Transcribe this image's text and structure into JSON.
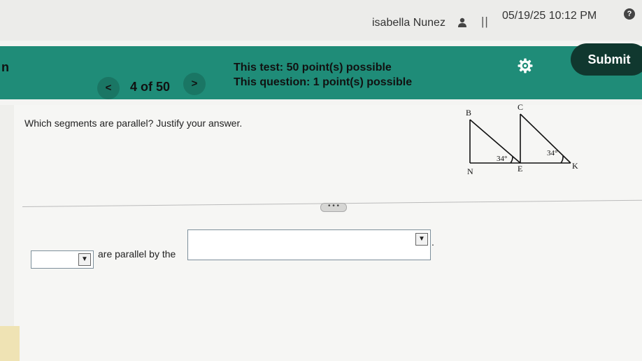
{
  "header": {
    "user_name": "isabella Nunez",
    "divider": "||",
    "datetime": "05/19/25 10:12 PM",
    "help_label": "?"
  },
  "toolbar": {
    "left_fragment": "n",
    "prev_label": "<",
    "position": "4 of 50",
    "next_label": ">",
    "test_points": "This test: 50 point(s) possible",
    "question_points": "This question: 1 point(s) possible",
    "submit_label": "Submit"
  },
  "question": {
    "text": "Which segments are parallel? Justify your answer.",
    "diagram": {
      "labels": {
        "B": "B",
        "C": "C",
        "N": "N",
        "E": "E",
        "K": "K"
      },
      "angle_left": "34°",
      "angle_right": "34°"
    },
    "more_label": "• • •"
  },
  "answer": {
    "segments_value": "",
    "middle_text": "are parallel by the",
    "reason_value": "",
    "period": ".",
    "arrow_glyph": "▼"
  },
  "colors": {
    "green_bar": "#1f8c78",
    "submit_bg": "#10382f",
    "page_bg": "#f4f4f2"
  }
}
